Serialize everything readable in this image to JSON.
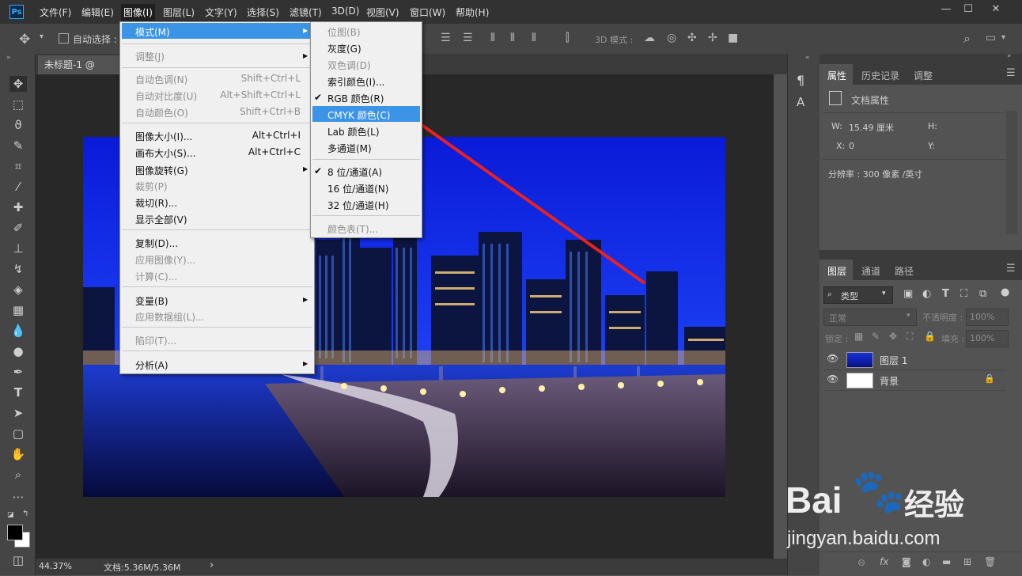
{
  "app": {
    "logo": "Ps"
  },
  "menubar": {
    "items": [
      "文件(F)",
      "编辑(E)",
      "图像(I)",
      "图层(L)",
      "文字(Y)",
      "选择(S)",
      "滤镜(T)",
      "3D(D)",
      "视图(V)",
      "窗口(W)",
      "帮助(H)"
    ]
  },
  "window_controls": {
    "minimize": "—",
    "maximize": "☐",
    "close": "✕"
  },
  "options_bar": {
    "auto_select": "自动选择 :",
    "mode_3d": "3D 模式 :"
  },
  "document": {
    "tab_title": "未标题-1 @ 44.4%"
  },
  "status": {
    "zoom": "44.37%",
    "doc": "文档:5.36M/5.36M",
    "arrow": "›"
  },
  "image_menu": {
    "items": [
      {
        "label": "模式(M)",
        "shortcut": "",
        "disabled": false,
        "submenu": true,
        "highlight": true
      },
      {
        "label": "调整(J)",
        "shortcut": "",
        "disabled": true,
        "submenu": true
      },
      {
        "label": "自动色调(N)",
        "shortcut": "Shift+Ctrl+L",
        "disabled": true
      },
      {
        "label": "自动对比度(U)",
        "shortcut": "Alt+Shift+Ctrl+L",
        "disabled": true
      },
      {
        "label": "自动颜色(O)",
        "shortcut": "Shift+Ctrl+B",
        "disabled": true
      },
      {
        "label": "图像大小(I)...",
        "shortcut": "Alt+Ctrl+I",
        "disabled": false
      },
      {
        "label": "画布大小(S)...",
        "shortcut": "Alt+Ctrl+C",
        "disabled": false
      },
      {
        "label": "图像旋转(G)",
        "shortcut": "",
        "disabled": false,
        "submenu": true
      },
      {
        "label": "裁剪(P)",
        "shortcut": "",
        "disabled": true
      },
      {
        "label": "裁切(R)...",
        "shortcut": "",
        "disabled": false
      },
      {
        "label": "显示全部(V)",
        "shortcut": "",
        "disabled": false
      },
      {
        "label": "复制(D)...",
        "shortcut": "",
        "disabled": false
      },
      {
        "label": "应用图像(Y)...",
        "shortcut": "",
        "disabled": true
      },
      {
        "label": "计算(C)...",
        "shortcut": "",
        "disabled": true
      },
      {
        "label": "变量(B)",
        "shortcut": "",
        "disabled": false,
        "submenu": true
      },
      {
        "label": "应用数据组(L)...",
        "shortcut": "",
        "disabled": true
      },
      {
        "label": "陷印(T)...",
        "shortcut": "",
        "disabled": true
      },
      {
        "label": "分析(A)",
        "shortcut": "",
        "disabled": false,
        "submenu": true
      }
    ]
  },
  "mode_submenu": {
    "items": [
      {
        "label": "位图(B)",
        "disabled": true,
        "checked": false
      },
      {
        "label": "灰度(G)",
        "disabled": false,
        "checked": false
      },
      {
        "label": "双色调(D)",
        "disabled": true,
        "checked": false
      },
      {
        "label": "索引颜色(I)...",
        "disabled": false,
        "checked": false
      },
      {
        "label": "RGB 颜色(R)",
        "disabled": false,
        "checked": true
      },
      {
        "label": "CMYK 颜色(C)",
        "disabled": false,
        "checked": false,
        "highlight": true
      },
      {
        "label": "Lab 颜色(L)",
        "disabled": false,
        "checked": false
      },
      {
        "label": "多通道(M)",
        "disabled": false,
        "checked": false
      },
      {
        "label": "8 位/通道(A)",
        "disabled": false,
        "checked": true
      },
      {
        "label": "16 位/通道(N)",
        "disabled": false,
        "checked": false
      },
      {
        "label": "32 位/通道(H)",
        "disabled": false,
        "checked": false
      },
      {
        "label": "颜色表(T)...",
        "disabled": true,
        "checked": false
      }
    ],
    "check_mark": "✔"
  },
  "properties_panel": {
    "tabs": [
      "属性",
      "历史记录",
      "调整"
    ],
    "doc_props": "文档属性",
    "w_label": "W:",
    "w_value": "15.49 厘米",
    "h_label": "H:",
    "x_label": "X:",
    "x_value": "0",
    "y_label": "Y:",
    "resolution": "分辨率 : 300 像素 /英寸"
  },
  "layers_panel": {
    "tabs": [
      "图层",
      "通道",
      "路径"
    ],
    "filter_kind": "类型",
    "blend_mode": "正常",
    "opacity_label": "不透明度 :",
    "opacity_value": "100%",
    "lock_label": "锁定 :",
    "fill_label": "填充 :",
    "fill_value": "100%",
    "layers": [
      {
        "name": "图层 1",
        "visible": true,
        "locked": false
      },
      {
        "name": "背景",
        "visible": true,
        "locked": true
      }
    ]
  },
  "watermark": {
    "brand": "Bai",
    "brand2": "经验",
    "url": "jingyan.baidu.com"
  },
  "colors": {
    "highlight": "#3c94e6",
    "annotation_arrow": "#e8231f"
  }
}
